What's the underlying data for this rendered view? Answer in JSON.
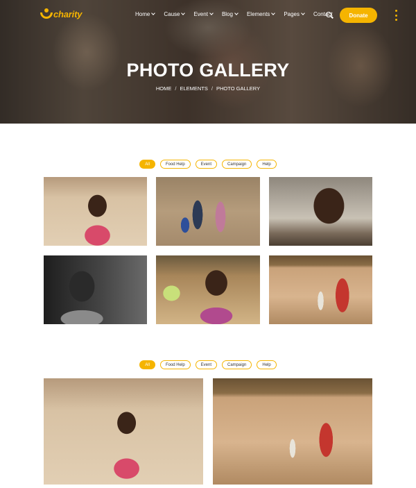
{
  "logo": {
    "text": "charity"
  },
  "nav": {
    "items": [
      {
        "label": "Home",
        "dropdown": true
      },
      {
        "label": "Cause",
        "dropdown": true
      },
      {
        "label": "Event",
        "dropdown": true
      },
      {
        "label": "Blog",
        "dropdown": true
      },
      {
        "label": "Elements",
        "dropdown": true
      },
      {
        "label": "Pages",
        "dropdown": true
      },
      {
        "label": "Contact",
        "dropdown": false
      }
    ],
    "donate_label": "Donate"
  },
  "hero": {
    "title": "PHOTO GALLERY",
    "breadcrumb": [
      "HOME",
      "ELEMENTS",
      "PHOTO GALLERY"
    ],
    "breadcrumb_separator": "/"
  },
  "filters": [
    "All",
    "Food Help",
    "Event",
    "Campaign",
    "Help"
  ],
  "active_filter": "All",
  "colors": {
    "accent": "#f5b400",
    "nav_text": "#ffffff"
  }
}
